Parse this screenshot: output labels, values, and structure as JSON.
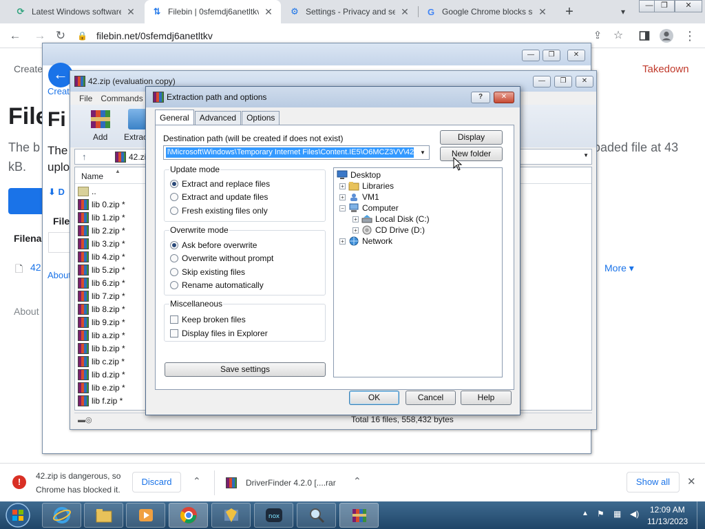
{
  "browser": {
    "tabs": [
      {
        "title": "Latest Windows software",
        "icon": "refresh-favicon-icon",
        "icon_color": "#2fa37d"
      },
      {
        "title": "Filebin | 0sfemdj6anetltkv",
        "icon": "updown-favicon-icon",
        "icon_color": "#1a73e8"
      },
      {
        "title": "Settings - Privacy and sec",
        "icon": "gear-favicon-icon",
        "icon_color": "#1a73e8"
      },
      {
        "title": "Google Chrome blocks so",
        "icon": "google-favicon-icon",
        "icon_color": "#4285f4"
      }
    ],
    "close_glyph": "✕",
    "new_tab_glyph": "+",
    "url": "filebin.net/0sfemdj6anetltkv"
  },
  "page": {
    "create": "Create",
    "takedown": "Takedown",
    "heading": "File",
    "line1_start": "The b",
    "line1_end": "oaded file at 43",
    "line2": "kB.",
    "more": "More",
    "about": "About",
    "behind_create": "Creat",
    "behind_fi": "Fi",
    "behind_the": "The",
    "behind_uplo": "uplo",
    "behind_file": "File",
    "behind_filena": "Filena",
    "behind_42": "42",
    "behind_about": "About",
    "behind_d": "D",
    "accent": "#1a73e8",
    "takedown_color": "#c0392b"
  },
  "winrar": {
    "title": "42.zip (evaluation copy)",
    "menu": [
      "File",
      "Commands"
    ],
    "toolbar": {
      "add": "Add",
      "extract": "Extrac"
    },
    "path_label": "42.zi",
    "column_name": "Name",
    "files": [
      "..",
      "lib 0.zip *",
      "lib 1.zip *",
      "lib 2.zip *",
      "lib 3.zip *",
      "lib 4.zip *",
      "lib 5.zip *",
      "lib 6.zip *",
      "lib 7.zip *",
      "lib 8.zip *",
      "lib 9.zip *",
      "lib a.zip *",
      "lib b.zip *",
      "lib c.zip *",
      "lib d.zip *",
      "lib e.zip *",
      "lib f.zip *"
    ],
    "status": "Total 16 files, 558,432 bytes"
  },
  "dialog": {
    "title": "Extraction path and options",
    "help_glyph": "?",
    "tabs": [
      "General",
      "Advanced",
      "Options"
    ],
    "dest_label": "Destination path (will be created if does not exist)",
    "dest_value": "l\\Microsoft\\Windows\\Temporary Internet Files\\Content.IE5\\O6MCZ3VV\\42",
    "display_btn": "Display",
    "new_folder_btn": "New folder",
    "update_mode": {
      "title": "Update mode",
      "options": [
        "Extract and replace files",
        "Extract and update files",
        "Fresh existing files only"
      ],
      "selected": 0
    },
    "overwrite_mode": {
      "title": "Overwrite mode",
      "options": [
        "Ask before overwrite",
        "Overwrite without prompt",
        "Skip existing files",
        "Rename automatically"
      ],
      "selected": 0
    },
    "misc": {
      "title": "Miscellaneous",
      "options": [
        "Keep broken files",
        "Display files in Explorer"
      ]
    },
    "save_settings": "Save settings",
    "tree": {
      "desktop": "Desktop",
      "libraries": "Libraries",
      "vm1": "VM1",
      "computer": "Computer",
      "local_disk": "Local Disk (C:)",
      "cd_drive": "CD Drive (D:)",
      "network": "Network"
    },
    "ok": "OK",
    "cancel": "Cancel",
    "help": "Help"
  },
  "downloads": {
    "item1_line1": "42.zip is dangerous, so",
    "item1_line2": "Chrome has blocked it.",
    "discard": "Discard",
    "item2": "DriverFinder 4.2.0 [....rar",
    "show_all": "Show all",
    "warning_color": "#d93025"
  },
  "taskbar": {
    "time": "12:09 AM",
    "date": "11/13/2023"
  }
}
